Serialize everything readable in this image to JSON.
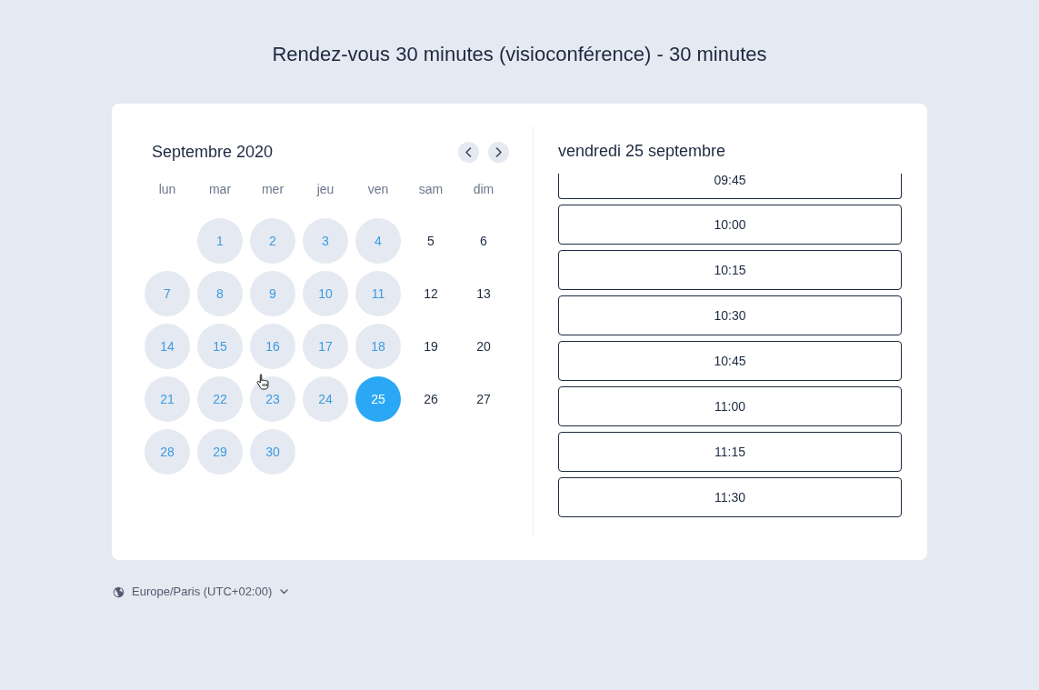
{
  "page_title": "Rendez-vous 30 minutes (visioconférence) - 30 minutes",
  "calendar": {
    "month": "Septembre 2020",
    "weekdays": [
      "lun",
      "mar",
      "mer",
      "jeu",
      "ven",
      "sam",
      "dim"
    ],
    "weeks": [
      [
        {
          "day": "1",
          "available": true,
          "selected": false
        },
        {
          "day": "2",
          "available": true,
          "selected": false
        },
        {
          "day": "3",
          "available": true,
          "selected": false
        },
        {
          "day": "4",
          "available": true,
          "selected": false
        },
        {
          "day": "5",
          "available": false,
          "selected": false
        },
        {
          "day": "6",
          "available": false,
          "selected": false
        }
      ],
      [
        {
          "day": "7",
          "available": true,
          "selected": false
        },
        {
          "day": "8",
          "available": true,
          "selected": false
        },
        {
          "day": "9",
          "available": true,
          "selected": false
        },
        {
          "day": "10",
          "available": true,
          "selected": false
        },
        {
          "day": "11",
          "available": true,
          "selected": false
        },
        {
          "day": "12",
          "available": false,
          "selected": false
        },
        {
          "day": "13",
          "available": false,
          "selected": false
        }
      ],
      [
        {
          "day": "14",
          "available": true,
          "selected": false
        },
        {
          "day": "15",
          "available": true,
          "selected": false
        },
        {
          "day": "16",
          "available": true,
          "selected": false
        },
        {
          "day": "17",
          "available": true,
          "selected": false
        },
        {
          "day": "18",
          "available": true,
          "selected": false
        },
        {
          "day": "19",
          "available": false,
          "selected": false
        },
        {
          "day": "20",
          "available": false,
          "selected": false
        }
      ],
      [
        {
          "day": "21",
          "available": true,
          "selected": false
        },
        {
          "day": "22",
          "available": true,
          "selected": false
        },
        {
          "day": "23",
          "available": true,
          "selected": false
        },
        {
          "day": "24",
          "available": true,
          "selected": false
        },
        {
          "day": "25",
          "available": true,
          "selected": true
        },
        {
          "day": "26",
          "available": false,
          "selected": false
        },
        {
          "day": "27",
          "available": false,
          "selected": false
        }
      ],
      [
        {
          "day": "28",
          "available": true,
          "selected": false
        },
        {
          "day": "29",
          "available": true,
          "selected": false
        },
        {
          "day": "30",
          "available": true,
          "selected": false
        }
      ]
    ]
  },
  "slots_panel": {
    "date": "vendredi 25 septembre",
    "slots": [
      {
        "time": "09:45",
        "selected": false
      },
      {
        "time": "10:00",
        "selected": false
      },
      {
        "time": "10:15",
        "selected": false
      },
      {
        "time": "10:30",
        "selected": false
      },
      {
        "time": "10:45",
        "selected": false
      },
      {
        "time": "11:00",
        "selected": false
      },
      {
        "time": "11:15",
        "selected": false
      },
      {
        "time": "11:30",
        "selected": false
      }
    ]
  },
  "timezone": {
    "label": "Europe/Paris (UTC+02:00)"
  }
}
